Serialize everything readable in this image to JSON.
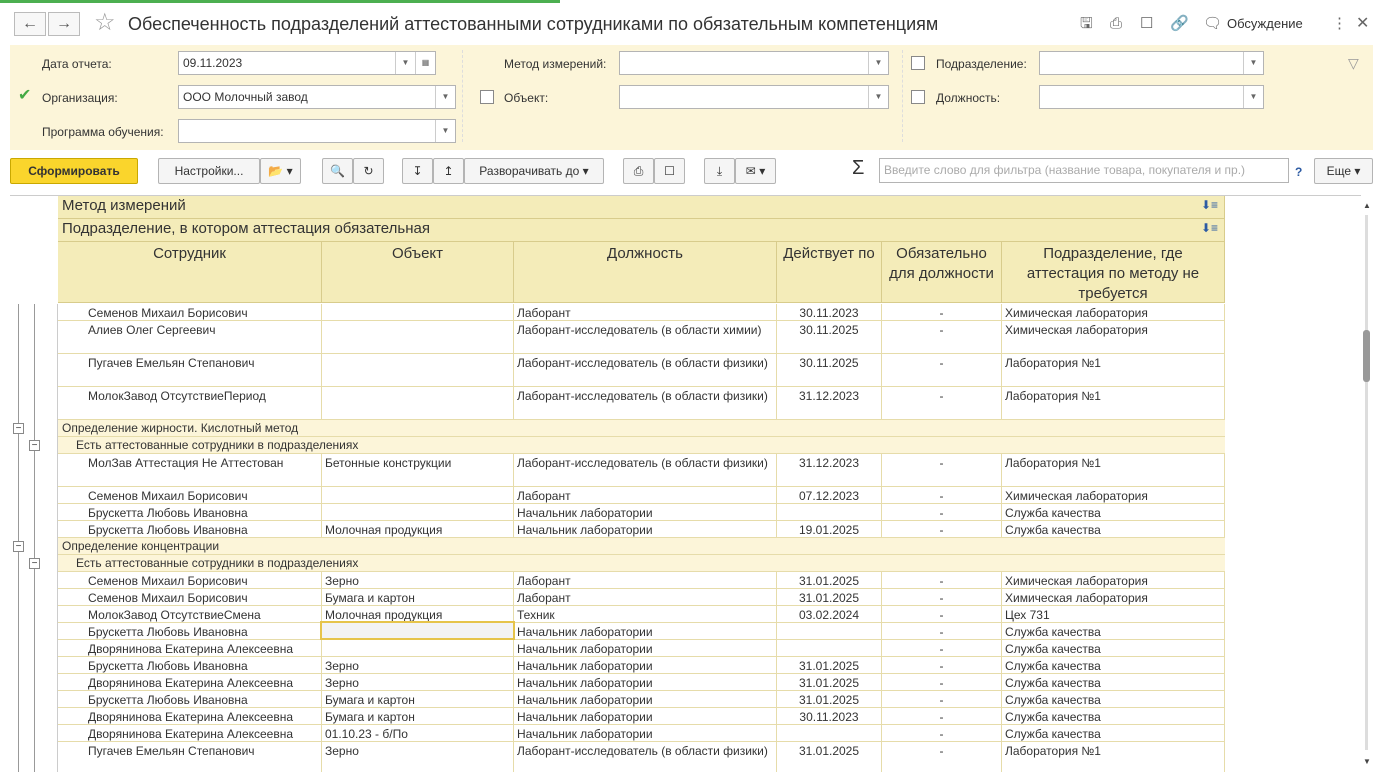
{
  "window": {
    "title": "Обеспеченность подразделений аттестованными сотрудниками по обязательным компетенциям",
    "discussion_label": "Обсуждение"
  },
  "filters": {
    "report_date_label": "Дата отчета:",
    "report_date_value": "09.11.2023",
    "organization_label": "Организация:",
    "organization_checked": true,
    "organization_value": "ООО Молочный завод",
    "program_label": "Программа обучения:",
    "program_value": "",
    "method_label": "Метод измерений:",
    "method_value": "",
    "object_label": "Объект:",
    "object_value": "",
    "department_label": "Подразделение:",
    "department_value": "",
    "position_label": "Должность:",
    "position_value": ""
  },
  "toolbar": {
    "generate_label": "Сформировать",
    "settings_label": "Настройки...",
    "expand_label": "Разворачивать до",
    "search_placeholder": "Введите слово для фильтра (название товара, покупателя и пр.)",
    "help_label": "?",
    "more_label": "Еще",
    "sigma": "Σ"
  },
  "report": {
    "group_header_1": "Метод измерений",
    "group_header_2": "Подразделение, в котором аттестация обязательная",
    "columns": {
      "employee": "Сотрудник",
      "object": "Объект",
      "position": "Должность",
      "valid_to": "Действует по",
      "mandatory": "Обязательно для должности",
      "dept_not_required": "Подразделение, где аттестация по методу не требуется"
    },
    "rows": [
      {
        "type": "data",
        "employee": "Семенов Михаил Борисович",
        "object": "",
        "position": "Лаборант",
        "valid_to": "30.11.2023",
        "mandatory": "-",
        "dept": "Химическая лаборатория",
        "tall": false
      },
      {
        "type": "data",
        "employee": "Алиев Олег Сергеевич",
        "object": "",
        "position": "Лаборант-исследователь (в области химии)",
        "valid_to": "30.11.2025",
        "mandatory": "-",
        "dept": "Химическая лаборатория",
        "tall": true
      },
      {
        "type": "data",
        "employee": "Пугачев Емельян Степанович",
        "object": "",
        "position": "Лаборант-исследователь (в области физики)",
        "valid_to": "30.11.2025",
        "mandatory": "-",
        "dept": "Лаборатория №1",
        "tall": true
      },
      {
        "type": "data",
        "employee": "МолокЗавод ОтсутствиеПериод",
        "object": "",
        "position": "Лаборант-исследователь (в области физики)",
        "valid_to": "31.12.2023",
        "mandatory": "-",
        "dept": "Лаборатория №1",
        "tall": true
      },
      {
        "type": "group1",
        "label": "Определение жирности. Кислотный метод"
      },
      {
        "type": "group2",
        "label": "Есть аттестованные сотрудники в подразделениях"
      },
      {
        "type": "data",
        "employee": "МолЗав Аттестация Не Аттестован",
        "object": "Бетонные конструкции",
        "position": "Лаборант-исследователь (в области физики)",
        "valid_to": "31.12.2023",
        "mandatory": "-",
        "dept": "Лаборатория №1",
        "tall": true
      },
      {
        "type": "data",
        "employee": "Семенов Михаил Борисович",
        "object": "",
        "position": "Лаборант",
        "valid_to": "07.12.2023",
        "mandatory": "-",
        "dept": "Химическая лаборатория",
        "tall": false
      },
      {
        "type": "data",
        "employee": "Брускетта Любовь Ивановна",
        "object": "",
        "position": "Начальник лаборатории",
        "valid_to": "",
        "mandatory": "-",
        "dept": "Служба качества",
        "tall": false
      },
      {
        "type": "data",
        "employee": "Брускетта Любовь Ивановна",
        "object": "Молочная продукция",
        "position": "Начальник лаборатории",
        "valid_to": "19.01.2025",
        "mandatory": "-",
        "dept": "Служба качества",
        "tall": false
      },
      {
        "type": "group1",
        "label": "Определение концентрации"
      },
      {
        "type": "group2",
        "label": "Есть аттестованные сотрудники в подразделениях"
      },
      {
        "type": "data",
        "employee": "Семенов Михаил Борисович",
        "object": "Зерно",
        "position": "Лаборант",
        "valid_to": "31.01.2025",
        "mandatory": "-",
        "dept": "Химическая лаборатория",
        "tall": false
      },
      {
        "type": "data",
        "employee": "Семенов Михаил Борисович",
        "object": "Бумага и картон",
        "position": "Лаборант",
        "valid_to": "31.01.2025",
        "mandatory": "-",
        "dept": "Химическая лаборатория",
        "tall": false
      },
      {
        "type": "data",
        "employee": "МолокЗавод ОтсутствиеСмена",
        "object": "Молочная продукция",
        "position": "Техник",
        "valid_to": "03.02.2024",
        "mandatory": "-",
        "dept": "Цех 731",
        "tall": false
      },
      {
        "type": "data",
        "employee": "Брускетта Любовь Ивановна",
        "object": "",
        "position": "Начальник лаборатории",
        "valid_to": "",
        "mandatory": "-",
        "dept": "Служба качества",
        "tall": false,
        "selected": true
      },
      {
        "type": "data",
        "employee": "Дворянинова Екатерина Алексеевна",
        "object": "",
        "position": "Начальник лаборатории",
        "valid_to": "",
        "mandatory": "-",
        "dept": "Служба качества",
        "tall": false
      },
      {
        "type": "data",
        "employee": "Брускетта Любовь Ивановна",
        "object": "Зерно",
        "position": "Начальник лаборатории",
        "valid_to": "31.01.2025",
        "mandatory": "-",
        "dept": "Служба качества",
        "tall": false
      },
      {
        "type": "data",
        "employee": "Дворянинова Екатерина Алексеевна",
        "object": "Зерно",
        "position": "Начальник лаборатории",
        "valid_to": "31.01.2025",
        "mandatory": "-",
        "dept": "Служба качества",
        "tall": false
      },
      {
        "type": "data",
        "employee": "Брускетта Любовь Ивановна",
        "object": "Бумага и картон",
        "position": "Начальник лаборатории",
        "valid_to": "31.01.2025",
        "mandatory": "-",
        "dept": "Служба качества",
        "tall": false
      },
      {
        "type": "data",
        "employee": "Дворянинова Екатерина Алексеевна",
        "object": "Бумага и картон",
        "position": "Начальник лаборатории",
        "valid_to": "30.11.2023",
        "mandatory": "-",
        "dept": "Служба качества",
        "tall": false
      },
      {
        "type": "data",
        "employee": "Дворянинова Екатерина Алексеевна",
        "object": "01.10.23 - б/По",
        "position": "Начальник лаборатории",
        "valid_to": "",
        "mandatory": "-",
        "dept": "Служба качества",
        "tall": false
      },
      {
        "type": "data",
        "employee": "Пугачев Емельян Степанович",
        "object": "Зерно",
        "position": "Лаборант-исследователь (в области физики)",
        "valid_to": "31.01.2025",
        "mandatory": "-",
        "dept": "Лаборатория №1",
        "tall": true
      }
    ]
  }
}
